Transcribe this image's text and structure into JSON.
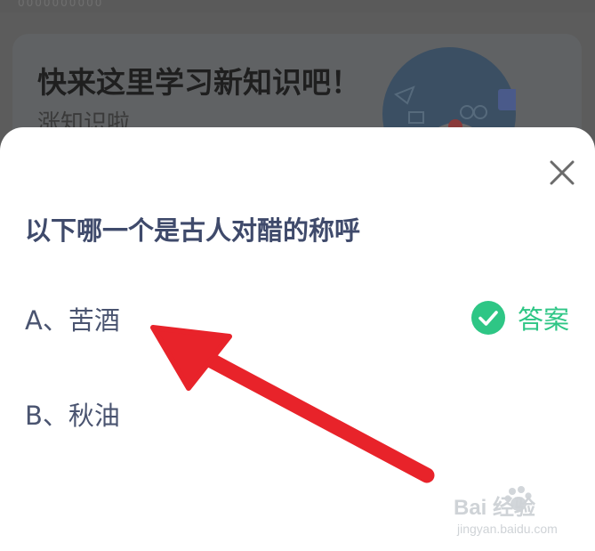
{
  "background": {
    "top_strip_text": "0000000000",
    "card_title": "快来这里学习新知识吧！",
    "card_subtitle": "涨知识啦"
  },
  "quiz": {
    "question": "以下哪一个是古人对醋的称呼",
    "options": [
      {
        "label": "A、苦酒",
        "is_answer": true
      },
      {
        "label": "B、秋油",
        "is_answer": false
      }
    ],
    "answer_label": "答案"
  },
  "watermark": {
    "main": "Bai 经验",
    "sub": "jingyan.baidu.com"
  },
  "colors": {
    "question_text": "#3f4a6b",
    "option_text": "#4a5470",
    "answer_green": "#2ec685",
    "arrow_red": "#e8232a"
  },
  "icons": {
    "close": "close-icon",
    "check": "check-circle-icon",
    "arrow": "red-arrow-annotation"
  }
}
